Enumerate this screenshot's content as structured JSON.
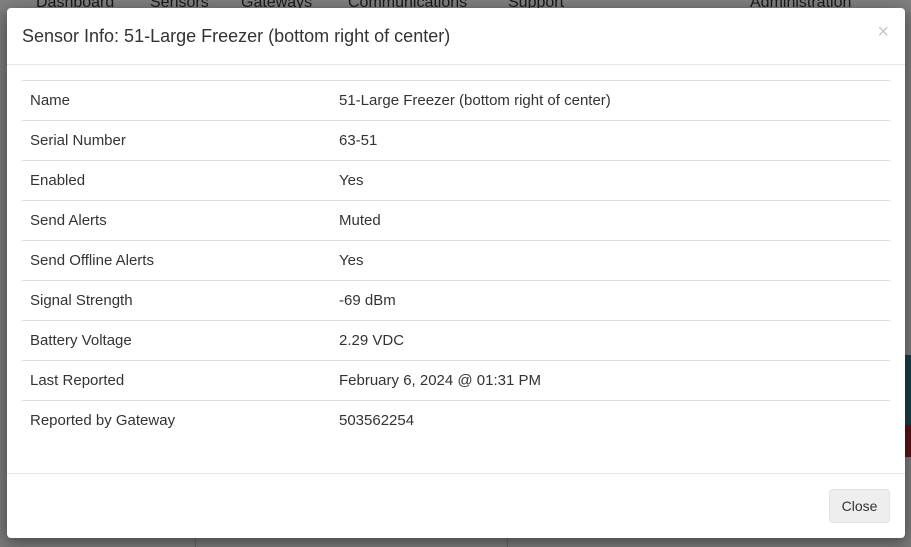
{
  "background_nav": {
    "items": [
      "Dashboard",
      "Sensors",
      "Gateways",
      "Communications",
      "Support",
      "Administration"
    ]
  },
  "modal": {
    "title": "Sensor Info: 51-Large Freezer (bottom right of center)",
    "close_icon": "×",
    "rows": [
      {
        "label": "Name",
        "value": "51-Large Freezer (bottom right of center)"
      },
      {
        "label": "Serial Number",
        "value": "63-51"
      },
      {
        "label": "Enabled",
        "value": "Yes"
      },
      {
        "label": "Send Alerts",
        "value": "Muted"
      },
      {
        "label": "Send Offline Alerts",
        "value": "Yes"
      },
      {
        "label": "Signal Strength",
        "value": "-69 dBm"
      },
      {
        "label": "Battery Voltage",
        "value": "2.29 VDC"
      },
      {
        "label": "Last Reported",
        "value": "February 6, 2024 @ 01:31 PM"
      },
      {
        "label": "Reported by Gateway",
        "value": "503562254"
      }
    ],
    "close_button": "Close"
  }
}
